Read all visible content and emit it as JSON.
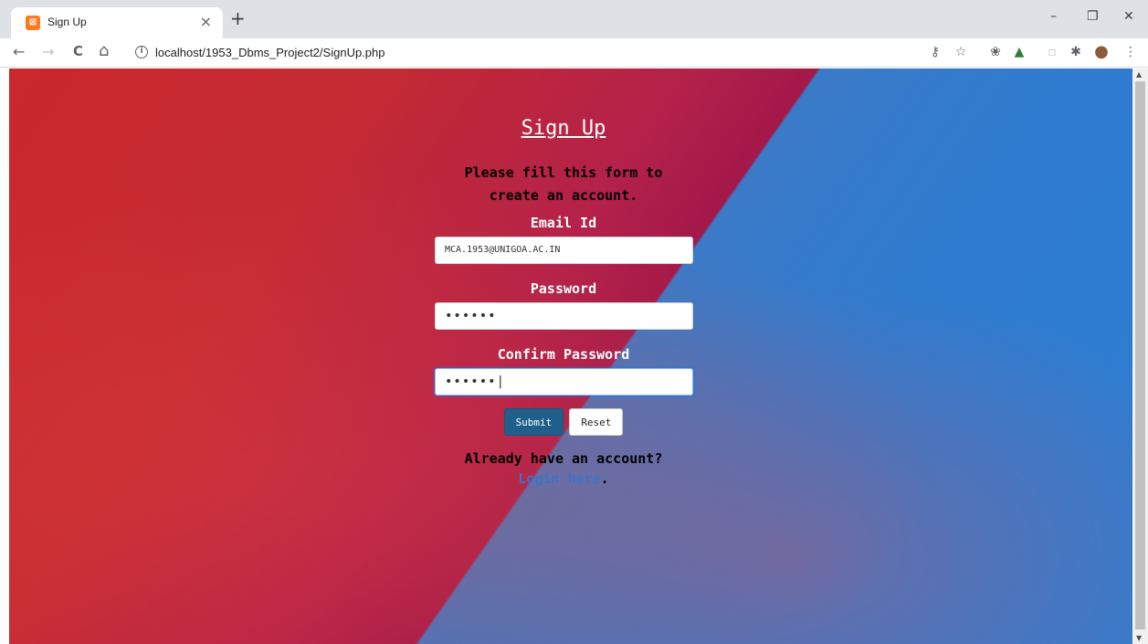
{
  "browser": {
    "tab_title": "Sign Up",
    "tab_icon_glyph": "⊠",
    "new_tab_glyph": "+",
    "close_glyph": "×",
    "url": "localhost/1953_Dbms_Project2/SignUp.php",
    "icons": {
      "back": "←",
      "forward": "→",
      "reload": "C",
      "home": "⌂",
      "info": "i",
      "key": "⚷",
      "star": "☆",
      "ext1": "❀",
      "ext2": "▲",
      "ext3": "▫",
      "extensions": "✱",
      "profile": "●",
      "menu": "⋮"
    },
    "window_controls": {
      "minimize": "–",
      "maximize": "❐",
      "close": "✕"
    }
  },
  "form": {
    "title": "Sign Up",
    "subtitle_line1": "Please fill this form to",
    "subtitle_line2": "create an account.",
    "email_label": "Email Id",
    "email_value": "MCA.1953@UNIGOA.AC.IN",
    "password_label": "Password",
    "password_value": "••••••",
    "confirm_label": "Confirm Password",
    "confirm_value": "••••••|",
    "submit_label": "Submit",
    "reset_label": "Reset",
    "already_text": "Already have an account?",
    "login_link": "Login here",
    "login_suffix": "."
  },
  "colors": {
    "accent_link": "#3a74c9",
    "submit_bg": "#1f5f8b",
    "bg_red": "#c9282c",
    "bg_blue": "#2f7dd1"
  },
  "scrollbar": {
    "up": "▲",
    "down": "▼"
  }
}
